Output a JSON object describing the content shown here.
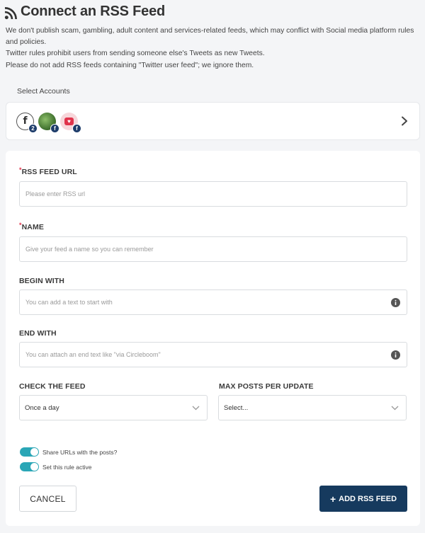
{
  "header": {
    "title": "Connect an RSS Feed",
    "desc_lines": [
      "We don't publish scam, gambling, adult content and services-related feeds, which may conflict with Social media platform rules",
      "and policies.",
      "Twitter rules prohibit users from sending someone else's Tweets as new Tweets.",
      "Please do not add RSS feeds containing \"Twitter user feed\"; we ignore them."
    ]
  },
  "accounts": {
    "label": "Select Accounts",
    "items": [
      {
        "icon": "facebook-f-icon",
        "glyph": "f",
        "badge": "2"
      },
      {
        "icon": "nature-avatar",
        "badge": "f"
      },
      {
        "icon": "heart-avatar",
        "glyph": "♥",
        "badge": "f"
      }
    ]
  },
  "form": {
    "rss_url": {
      "label": "RSS FEED URL",
      "required_mark": "*",
      "placeholder": "Please enter RSS url"
    },
    "name": {
      "label": "NAME",
      "required_mark": "*",
      "placeholder": "Give your feed a name so you can remember"
    },
    "begin_with": {
      "label": "BEGIN WITH",
      "placeholder": "You can add a text to start with"
    },
    "end_with": {
      "label": "END WITH",
      "placeholder": "You can attach an end text like \"via Circleboom\""
    },
    "check_feed": {
      "label": "CHECK THE FEED",
      "value": "Once a day"
    },
    "max_posts": {
      "label": "MAX POSTS PER UPDATE",
      "value": "Select..."
    },
    "toggles": {
      "share_urls": {
        "label": "Share URLs with the posts?",
        "on": true
      },
      "rule_active": {
        "label": "Set this rule active",
        "on": true
      }
    },
    "cancel_label": "CANCEL",
    "add_label": "ADD RSS FEED",
    "add_plus": "+"
  },
  "colors": {
    "primary": "#163a5e",
    "toggle": "#2aa6b6",
    "required": "#e0334b",
    "background": "#f4f5f7"
  }
}
